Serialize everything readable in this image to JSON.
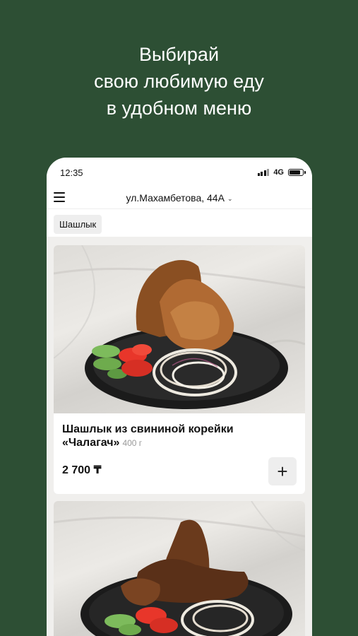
{
  "promo": {
    "line1": "Выбирай",
    "line2": "свою любимую еду",
    "line3": "в удобном меню"
  },
  "status_bar": {
    "time": "12:35",
    "network": "4G"
  },
  "header": {
    "address": "ул.Махамбетова, 44А",
    "chevron": "⌄"
  },
  "categories": [
    {
      "label": "Шашлык"
    }
  ],
  "products": [
    {
      "title": "Шашлык из свининой корейки «Чалагач»",
      "weight": "400 г",
      "price": "2 700 ₸",
      "add_label": "+"
    }
  ],
  "colors": {
    "background": "#2d4f34",
    "card": "#ffffff",
    "chip": "#eeeeee"
  }
}
